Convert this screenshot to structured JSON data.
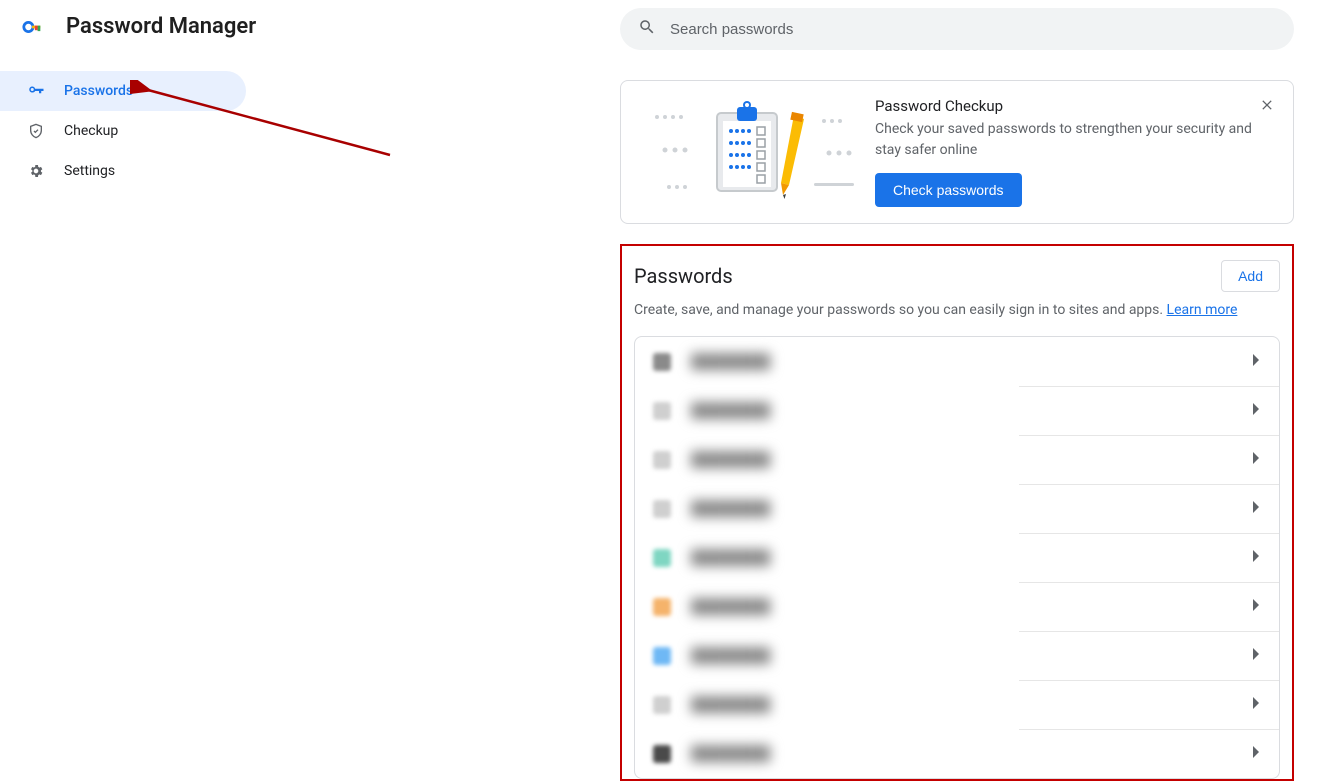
{
  "app": {
    "title": "Password Manager"
  },
  "sidebar": {
    "items": [
      {
        "label": "Passwords",
        "iconColor": "#1a73e8"
      },
      {
        "label": "Checkup",
        "iconColor": "#5f6368"
      },
      {
        "label": "Settings",
        "iconColor": "#5f6368"
      }
    ]
  },
  "search": {
    "placeholder": "Search passwords"
  },
  "checkup_card": {
    "title": "Password Checkup",
    "desc": "Check your saved passwords to strengthen your security and stay safer online",
    "button": "Check passwords"
  },
  "passwords_section": {
    "title": "Passwords",
    "add_label": "Add",
    "subtitle": "Create, save, and manage your passwords so you can easily sign in to sites and apps. ",
    "learn_more": "Learn more",
    "items": [
      {
        "label": "████████",
        "favicon": "#8a8a8a"
      },
      {
        "label": "████████",
        "favicon": "#cfcfcf"
      },
      {
        "label": "████████",
        "favicon": "#cfcfcf"
      },
      {
        "label": "████████",
        "favicon": "#cfcfcf"
      },
      {
        "label": "████████",
        "favicon": "#7fd6c2"
      },
      {
        "label": "████████",
        "favicon": "#f5b36b"
      },
      {
        "label": "████████",
        "favicon": "#6fb8f5"
      },
      {
        "label": "████████",
        "favicon": "#cfcfcf"
      },
      {
        "label": "████████",
        "favicon": "#4a4a4a"
      }
    ]
  }
}
